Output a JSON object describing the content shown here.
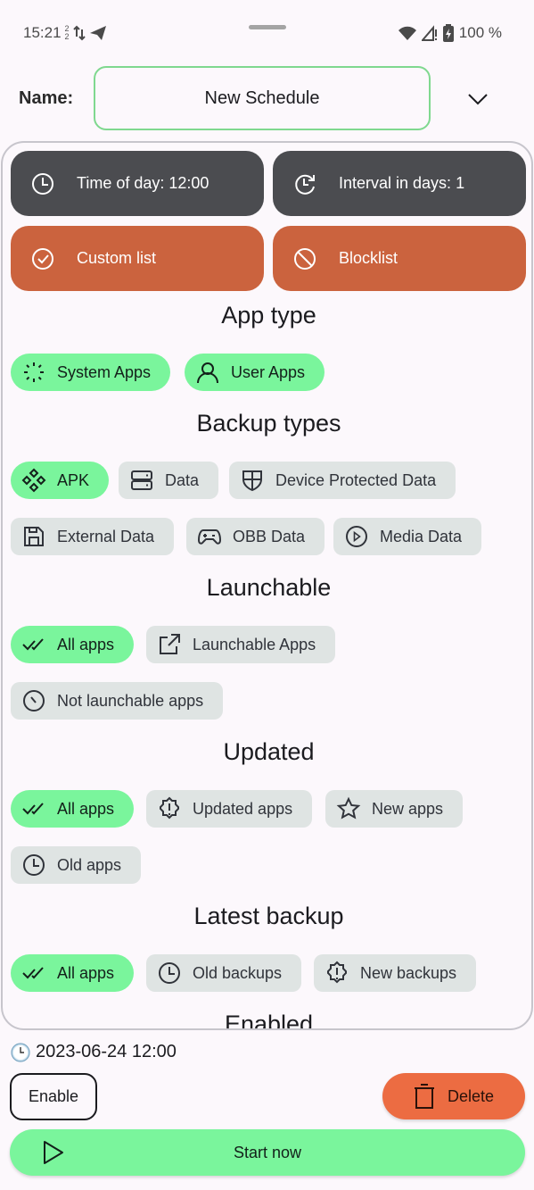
{
  "status_bar": {
    "time": "15:21",
    "notif_top": "2",
    "notif_bottom": "2",
    "battery": "100 %",
    "icons": [
      "data-transfer-icon",
      "telegram-icon",
      "wifi-icon",
      "signal-icon",
      "battery-charging-icon"
    ]
  },
  "header": {
    "name_label": "Name:",
    "name_value": "New Schedule"
  },
  "buttons": {
    "time_of_day": "Time of day: 12:00",
    "interval": "Interval in days: 1",
    "custom_list": "Custom list",
    "blocklist": "Blocklist"
  },
  "sections": {
    "app_type": {
      "title": "App type",
      "chips": [
        {
          "label": "System Apps",
          "icon": "spinner-icon",
          "selected": true
        },
        {
          "label": "User Apps",
          "icon": "user-icon",
          "selected": true
        }
      ]
    },
    "backup_types": {
      "title": "Backup types",
      "chips": [
        {
          "label": "APK",
          "icon": "diamonds-icon",
          "selected": true
        },
        {
          "label": "Data",
          "icon": "storage-icon",
          "selected": false
        },
        {
          "label": "Device Protected Data",
          "icon": "shield-icon",
          "selected": false
        },
        {
          "label": "External Data",
          "icon": "floppy-icon",
          "selected": false
        },
        {
          "label": "OBB Data",
          "icon": "gamepad-icon",
          "selected": false
        },
        {
          "label": "Media Data",
          "icon": "play-circle-icon",
          "selected": false
        }
      ]
    },
    "launchable": {
      "title": "Launchable",
      "chips": [
        {
          "label": "All apps",
          "icon": "double-check-icon",
          "selected": true
        },
        {
          "label": "Launchable Apps",
          "icon": "external-link-icon",
          "selected": false
        },
        {
          "label": "Not launchable apps",
          "icon": "slash-circle-icon",
          "selected": false
        }
      ]
    },
    "updated": {
      "title": "Updated",
      "chips": [
        {
          "label": "All apps",
          "icon": "double-check-icon",
          "selected": true
        },
        {
          "label": "Updated apps",
          "icon": "badge-alert-icon",
          "selected": false
        },
        {
          "label": "New apps",
          "icon": "star-icon",
          "selected": false
        },
        {
          "label": "Old apps",
          "icon": "clock-icon",
          "selected": false
        }
      ]
    },
    "latest_backup": {
      "title": "Latest backup",
      "chips": [
        {
          "label": "All apps",
          "icon": "double-check-icon",
          "selected": true
        },
        {
          "label": "Old backups",
          "icon": "clock-icon",
          "selected": false
        },
        {
          "label": "New backups",
          "icon": "badge-alert-icon",
          "selected": false
        }
      ]
    },
    "enabled": {
      "title": "Enabled"
    }
  },
  "footer": {
    "next_run": "2023-06-24 12:00",
    "enable_label": "Enable",
    "delete_label": "Delete",
    "start_label": "Start now"
  },
  "colors": {
    "accent_green": "#7af59c",
    "accent_orange": "#cb633e",
    "delete_orange": "#ec6c42",
    "dark_button": "#4b4c50",
    "chip_unselected": "#dfe4e3",
    "input_border": "#7fd88f"
  }
}
